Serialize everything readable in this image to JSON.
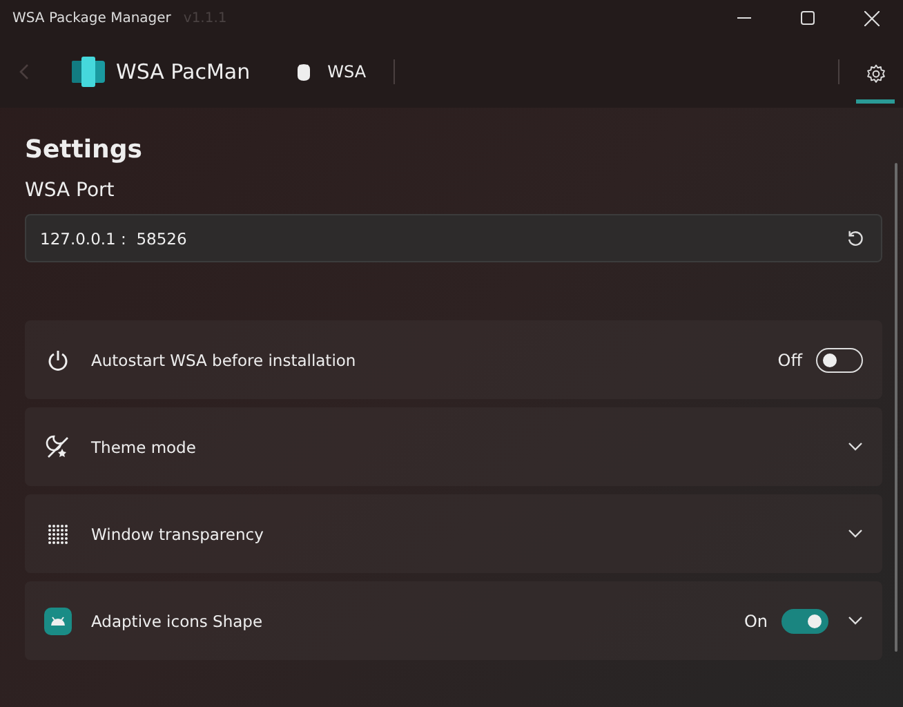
{
  "window": {
    "title": "WSA Package Manager",
    "version": "v1.1.1"
  },
  "nav": {
    "app_name": "WSA PacMan",
    "items": [
      {
        "label": "WSA",
        "selected": false
      }
    ],
    "settings_selected": true
  },
  "page": {
    "title": "Settings",
    "port_label": "WSA Port",
    "port_value": "127.0.0.1 :  58526"
  },
  "cards": [
    {
      "kind": "power",
      "label": "Autostart WSA before installation",
      "toggle": {
        "on": false,
        "text": "Off"
      },
      "expandable": false
    },
    {
      "kind": "theme",
      "label": "Theme mode",
      "expandable": true
    },
    {
      "kind": "dots",
      "label": "Window transparency",
      "expandable": true
    },
    {
      "kind": "android",
      "label": "Adaptive icons Shape",
      "toggle": {
        "on": true,
        "text": "On"
      },
      "expandable": true
    }
  ]
}
